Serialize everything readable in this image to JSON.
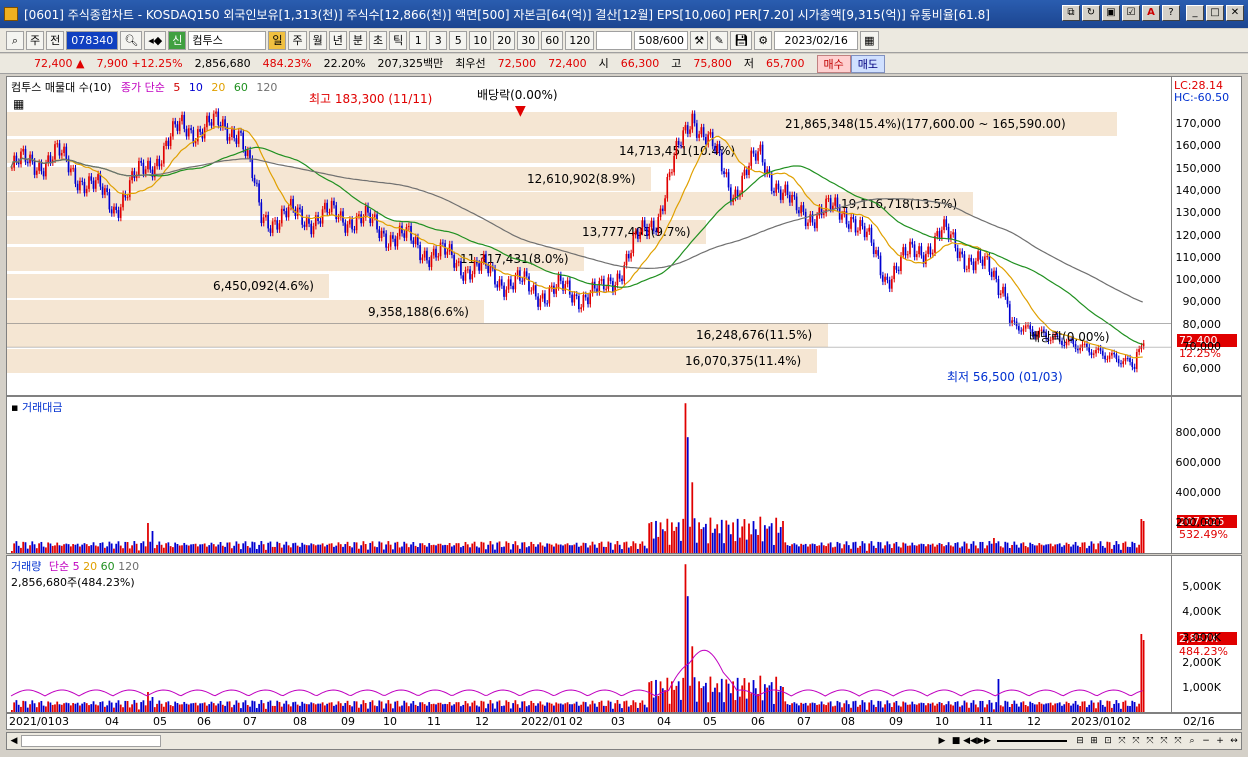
{
  "title": {
    "text": "[0601] 주식종합차트 - KOSDAQ150 외국인보유[1,313(천)] 주식수[12,866(천)] 액면[500] 자본금[64(억)] 결산[12월] EPS[10,060] PER[7.20] 시가총액[9,315(억)] 유통비율[61.8]"
  },
  "toolbar": {
    "market": "주",
    "all_label": "전",
    "code": "078340",
    "broker_prefix": "신",
    "broker": "컴투스",
    "periods": [
      "일",
      "주",
      "월",
      "년",
      "분",
      "초",
      "틱"
    ],
    "intervals": [
      "1",
      "3",
      "5",
      "10",
      "20",
      "30",
      "60",
      "120"
    ],
    "count": "508/600",
    "date": "2023/02/16"
  },
  "quote": {
    "price": "72,400",
    "arrow": "▲",
    "change": "7,900",
    "change_pct": "+12.25%",
    "volume": "2,856,680",
    "volume_pct": "484.23%",
    "turnover": "22.20%",
    "amount": "207,325백만",
    "best_ask_label": "최우선",
    "best_ask": "72,500",
    "best_bid": "72,400",
    "open_label": "시",
    "open": "66,300",
    "high_label": "고",
    "high": "75,800",
    "low_label": "저",
    "low": "65,700",
    "buy_label": "매수",
    "sell_label": "매도"
  },
  "price_panel": {
    "title": "컴투스 매물대 수(10)",
    "ma_label": "종가 단순",
    "ma_periods": [
      "5",
      "10",
      "20",
      "60",
      "120"
    ],
    "ma_colors": [
      "#d00000",
      "#0000d0",
      "#e0a000",
      "#209020",
      "#707070"
    ],
    "lc": "LC:28.14",
    "hc": "HC:-60.50",
    "y_ticks": [
      "170,000",
      "160,000",
      "150,000",
      "140,000",
      "130,000",
      "120,000",
      "110,000",
      "100,000",
      "90,000",
      "80,000",
      "70,000",
      "60,000"
    ],
    "last_value": "72,400",
    "last_pct": "12.25%",
    "annotations": {
      "high": "최고 183,300 (11/11)",
      "low": "최저 56,500 (01/03)",
      "dividend1": "배당락(0.00%)",
      "dividend2": "배당락(0.00%)"
    },
    "volume_profile": [
      {
        "label": "21,865,348(15.4%)(177,600.00 ~ 165,590.00)",
        "fraction": 1.0
      },
      {
        "label": "14,713,451(10.4%)",
        "fraction": 0.67
      },
      {
        "label": "12,610,902(8.9%)",
        "fraction": 0.58
      },
      {
        "label": "19,116,718(13.5%)",
        "fraction": 0.87
      },
      {
        "label": "13,777,405(9.7%)",
        "fraction": 0.63
      },
      {
        "label": "11,317,431(8.0%)",
        "fraction": 0.52
      },
      {
        "label": "6,450,092(4.6%)",
        "fraction": 0.29
      },
      {
        "label": "9,358,188(6.6%)",
        "fraction": 0.43
      },
      {
        "label": "16,248,676(11.5%)",
        "fraction": 0.74
      },
      {
        "label": "16,070,375(11.4%)",
        "fraction": 0.73
      }
    ]
  },
  "amount_panel": {
    "title": "거래대금",
    "y_ticks": [
      "800,000",
      "600,000",
      "400,000",
      "200,000"
    ],
    "last_value": "207,325",
    "last_pct": "532.49%"
  },
  "volume_panel": {
    "title": "거래량",
    "ma_label": "단순",
    "ma_periods": [
      "5",
      "20",
      "60",
      "120"
    ],
    "ma_colors": [
      "#c000c0",
      "#e0a000",
      "#209020",
      "#707070"
    ],
    "info": "2,856,680주(484.23%)",
    "y_ticks": [
      "5,000K",
      "4,000K",
      "3,000K",
      "2,000K",
      "1,000K"
    ],
    "last_value": "2,857K",
    "last_pct": "484.23%"
  },
  "date_axis": [
    "2021/01",
    "03",
    "04",
    "05",
    "06",
    "07",
    "08",
    "09",
    "10",
    "11",
    "12",
    "2022/01",
    "02",
    "03",
    "04",
    "05",
    "06",
    "07",
    "08",
    "09",
    "10",
    "11",
    "12",
    "2023/01",
    "02",
    "02/16"
  ],
  "colors": {
    "up": "#e00000",
    "down": "#0000d0",
    "profile": "#f5e6d3"
  }
}
